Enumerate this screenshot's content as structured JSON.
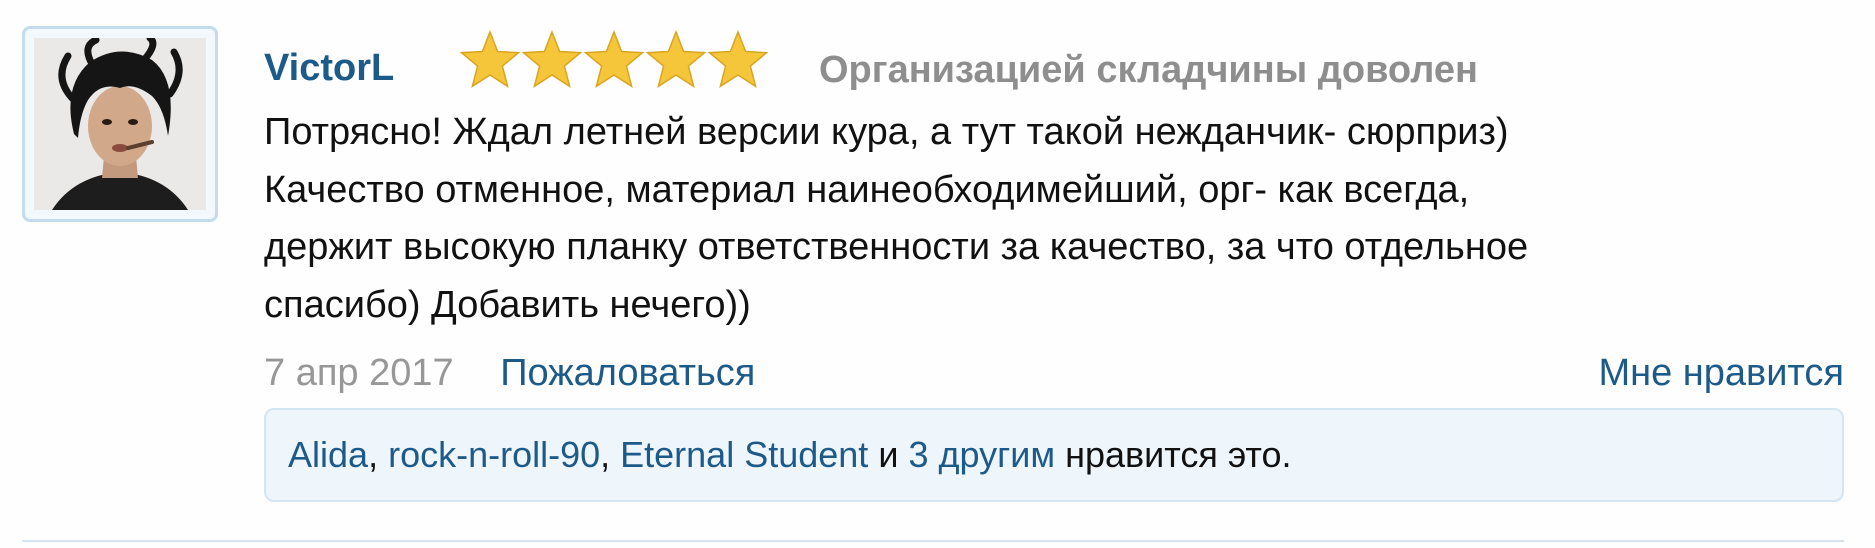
{
  "review": {
    "username": "VictorL",
    "rating": 5,
    "rating_max": 5,
    "rating_title": "Организацией складчины доволен",
    "text_lines": [
      "Потрясно! Ждал летней версии кура, а тут такой нежданчик- сюрприз)",
      "Качество отменное, материал наинеобходимейший, орг- как всегда,",
      "держит высокую планку ответственности за качество, за что отдельное",
      "спасибо) Добавить нечего))"
    ],
    "date": "7 апр 2017",
    "report_label": "Пожаловаться",
    "like_label": "Мне нравится"
  },
  "likes": {
    "users": [
      "Alida",
      "rock-n-roll-90",
      "Eternal Student"
    ],
    "separator": ", ",
    "conjunction": " и ",
    "others_label": "3 другим",
    "suffix": " нравится это."
  },
  "colors": {
    "link": "#1c5a8a",
    "muted": "#8e8e8e",
    "star": "#f6c63a",
    "likes_bg": "#eef5fb"
  }
}
